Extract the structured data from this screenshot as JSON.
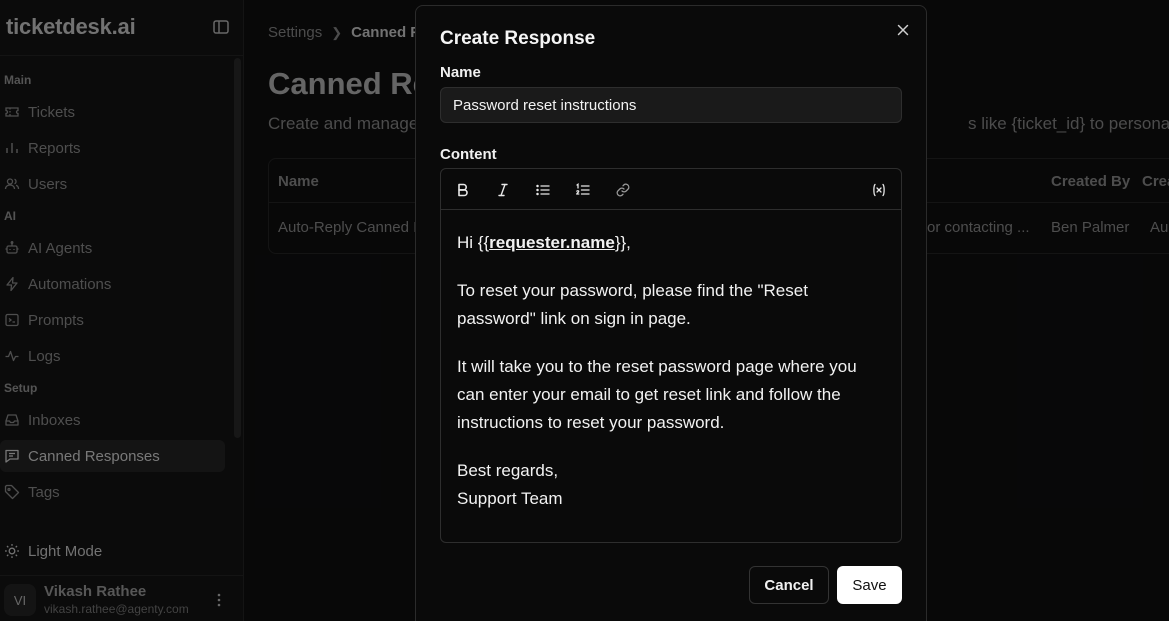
{
  "app": {
    "logo": "ticketdesk.ai"
  },
  "sidebar": {
    "sections": [
      {
        "label": "Main"
      },
      {
        "label": "AI"
      },
      {
        "label": "Setup"
      }
    ],
    "items": [
      {
        "label": "Tickets",
        "icon": "ticket-icon"
      },
      {
        "label": "Reports",
        "icon": "bar-chart-icon"
      },
      {
        "label": "Users",
        "icon": "users-icon"
      },
      {
        "label": "AI Agents",
        "icon": "bot-icon"
      },
      {
        "label": "Automations",
        "icon": "zap-icon"
      },
      {
        "label": "Prompts",
        "icon": "terminal-icon"
      },
      {
        "label": "Logs",
        "icon": "activity-icon"
      },
      {
        "label": "Inboxes",
        "icon": "inbox-icon"
      },
      {
        "label": "Canned Responses",
        "icon": "message-icon",
        "active": true
      },
      {
        "label": "Tags",
        "icon": "tag-icon"
      }
    ],
    "light_mode": "Light Mode",
    "user": {
      "initials": "VI",
      "name": "Vikash Rathee",
      "email": "vikash.rathee@agenty.com"
    }
  },
  "page": {
    "breadcrumb": {
      "parent": "Settings",
      "current": "Canned R"
    },
    "title": "Canned Re",
    "description": "Create and manage",
    "description_tail": "s like {ticket_id} to personalize y",
    "table": {
      "headers": {
        "name": "Name",
        "created_by": "Created By",
        "created_at": "Crea"
      },
      "row": {
        "name": "Auto-Reply Canned I",
        "content": "or contacting ...",
        "created_by": "Ben Palmer",
        "created_at": "Aug"
      }
    }
  },
  "modal": {
    "title": "Create Response",
    "name_label": "Name",
    "name_value": "Password reset instructions",
    "content_label": "Content",
    "content": {
      "greeting_prefix": "Hi {{",
      "variable": "requester.name",
      "greeting_suffix": "}},",
      "p1": "To reset your password, please find the \"Reset password\" link on sign in page.",
      "p2": "It will take you to the reset password page where you can enter your email to get  reset link and follow the instructions to reset your password.",
      "p3_line1": "Best regards,",
      "p3_line2": "Support Team"
    },
    "cancel_label": "Cancel",
    "save_label": "Save"
  }
}
